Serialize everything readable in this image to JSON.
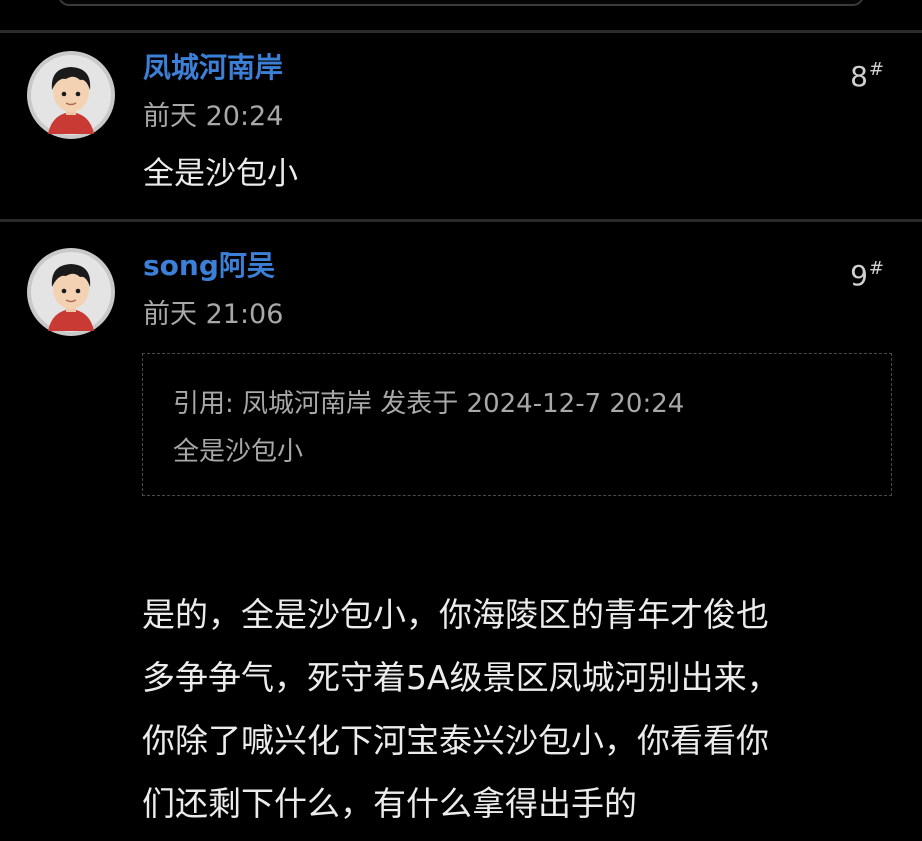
{
  "posts": [
    {
      "username": "凤城河南岸",
      "floor": "8",
      "floor_mark": "#",
      "time": "前天 20:24",
      "content": "全是沙包小"
    },
    {
      "username": "song阿吴",
      "floor": "9",
      "floor_mark": "#",
      "time": "前天 21:06",
      "quote": {
        "header": "引用: 凤城河南岸 发表于 2024-12-7 20:24",
        "body": "全是沙包小"
      },
      "content_lines": [
        "是的，全是沙包小，你海陵区的青年才俊也",
        "多争争气，死守着5A级景区凤城河别出来，",
        "你除了喊兴化下河宝泰兴沙包小，你看看你",
        "们还剩下什么，有什么拿得出手的"
      ]
    }
  ],
  "colors": {
    "background": "#000000",
    "username": "#3c7fd6",
    "body_text": "#ececec",
    "meta_text": "#a8a8a8",
    "divider": "#2b2b2b"
  },
  "icons": {
    "avatar": "cartoon-boy-avatar-icon"
  }
}
